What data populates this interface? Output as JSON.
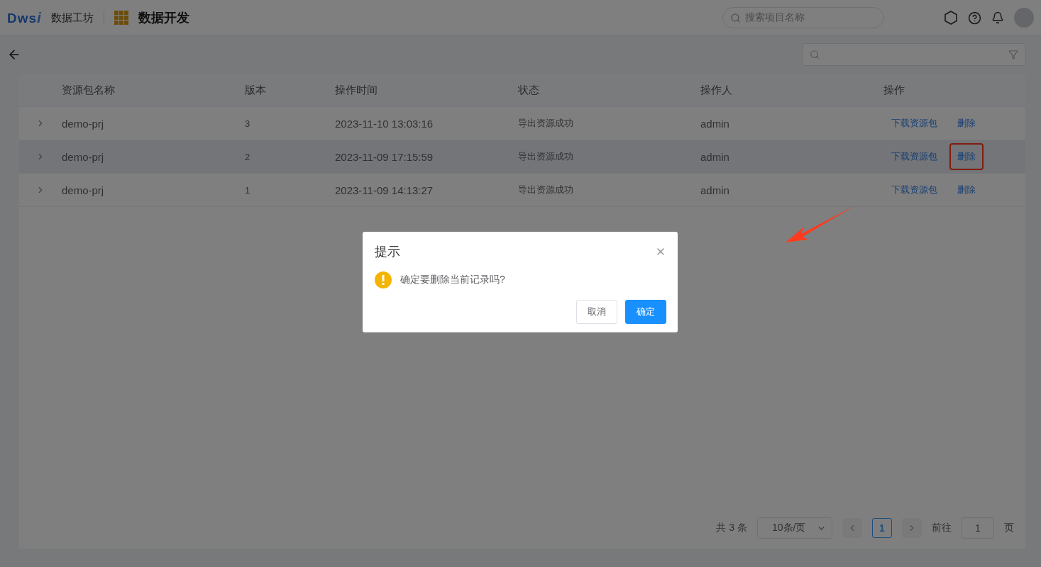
{
  "header": {
    "logo": "Dws",
    "logo_mark": "i",
    "product": "数据工坊",
    "module": "数据开发",
    "search": {
      "placeholder": "搜索项目名称"
    }
  },
  "table": {
    "columns": [
      "资源包名称",
      "版本",
      "操作时间",
      "状态",
      "操作人",
      "操作"
    ],
    "rows": [
      {
        "expanded": false,
        "hovered": false,
        "cells": [
          "demo-prj",
          "3",
          "2023-11-10 13:03:16",
          "导出资源成功",
          "admin"
        ],
        "actions": [
          {
            "label": "下载资源包",
            "annotated": false
          },
          {
            "label": "删除",
            "annotated": false
          }
        ]
      },
      {
        "expanded": false,
        "hovered": true,
        "cells": [
          "demo-prj",
          "2",
          "2023-11-09 17:15:59",
          "导出资源成功",
          "admin"
        ],
        "actions": [
          {
            "label": "下载资源包",
            "annotated": false
          },
          {
            "label": "删除",
            "annotated": true
          }
        ]
      },
      {
        "expanded": false,
        "hovered": false,
        "cells": [
          "demo-prj",
          "1",
          "2023-11-09 14:13:27",
          "导出资源成功",
          "admin"
        ],
        "actions": [
          {
            "label": "下载资源包",
            "annotated": false
          },
          {
            "label": "删除",
            "annotated": false
          }
        ]
      }
    ]
  },
  "pagination": {
    "total": "共 3 条",
    "page_size": "10条/页",
    "pages": [
      {
        "label": "1",
        "selected": true
      }
    ],
    "goto_label": "前往",
    "goto_value": "1",
    "goto_suffix": "页"
  },
  "dialog": {
    "title": "提示",
    "message": "确定要删除当前记录吗?",
    "buttons": [
      {
        "label": "取消",
        "kind": "default"
      },
      {
        "label": "确定",
        "kind": "primary"
      }
    ]
  },
  "annotation": {
    "arrow": true
  }
}
